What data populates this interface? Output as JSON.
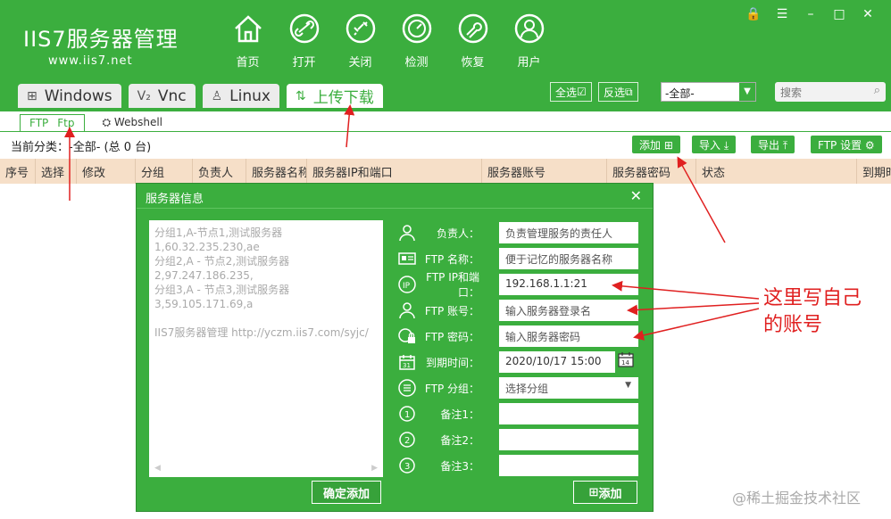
{
  "brand": {
    "name": "IIS7服务器管理",
    "url": "www.iis7.net"
  },
  "nav": [
    {
      "label": "首页",
      "icon": "home-icon"
    },
    {
      "label": "打开",
      "icon": "link-icon"
    },
    {
      "label": "关闭",
      "icon": "unlink-icon"
    },
    {
      "label": "检测",
      "icon": "gauge-icon"
    },
    {
      "label": "恢复",
      "icon": "wrench-icon"
    },
    {
      "label": "用户",
      "icon": "user-icon"
    }
  ],
  "tabs": [
    {
      "label": "Windows",
      "icon": "windows-icon"
    },
    {
      "label": "Vnc",
      "icon": "vnc-icon"
    },
    {
      "label": "Linux",
      "icon": "linux-icon"
    },
    {
      "label": "上传下载",
      "icon": "upload-download-icon"
    }
  ],
  "header_buttons": {
    "select_all": "全选",
    "invert": "反选"
  },
  "category_select": "-全部-",
  "search_placeholder": "搜索",
  "subtabs": {
    "ftp1": "FTP",
    "ftp2": "Ftp",
    "webshell": "Webshell"
  },
  "current_category": "当前分类：-全部- (总 0 台)",
  "toolbar": {
    "add": "添加",
    "import": "导入",
    "export": "导出",
    "ftp_settings": "FTP 设置"
  },
  "columns": [
    "序号",
    "选择",
    "修改",
    "分组",
    "负责人",
    "服务器名称",
    "服务器IP和端口",
    "服务器账号",
    "服务器密码",
    "状态",
    "到期时"
  ],
  "dialog": {
    "title": "服务器信息",
    "left_text": [
      "分组1,A-节点1,测试服务器1,60.32.235.230,ae",
      "分组2,A - 节点2,测试服务器2,97.247.186.235,",
      "分组3,A - 节点3,测试服务器3,59.105.171.69,a",
      "",
      "IIS7服务器管理 http://yczm.iis7.com/syjc/"
    ],
    "fields": [
      {
        "label": "负责人：",
        "value": "负责管理服务的责任人",
        "icon": "person-icon"
      },
      {
        "label": "FTP 名称：",
        "value": "便于记忆的服务器名称",
        "icon": "id-card-icon"
      },
      {
        "label": "FTP IP和端口：",
        "value": "192.168.1.1:21",
        "icon": "ip-icon"
      },
      {
        "label": "FTP 账号：",
        "value": "输入服务器登录名",
        "icon": "account-icon"
      },
      {
        "label": "FTP 密码：",
        "value": "输入服务器密码",
        "icon": "lock-icon"
      },
      {
        "label": "到期时间：",
        "value": "2020/10/17 15:00",
        "icon": "calendar-icon"
      },
      {
        "label": "FTP 分组：",
        "value": "选择分组",
        "icon": "group-icon"
      },
      {
        "label": "备注1：",
        "value": "",
        "icon": "number-1-icon"
      },
      {
        "label": "备注2：",
        "value": "",
        "icon": "number-2-icon"
      },
      {
        "label": "备注3：",
        "value": "",
        "icon": "number-3-icon"
      }
    ],
    "confirm_add": "确定添加",
    "add": "添加"
  },
  "annotation": [
    "这里写自己",
    "的账号"
  ],
  "watermark": "@稀土掘金技术社区",
  "colors": {
    "primary": "#3bae3e",
    "header_row": "#f6dfc8",
    "annotation": "#e02020"
  }
}
